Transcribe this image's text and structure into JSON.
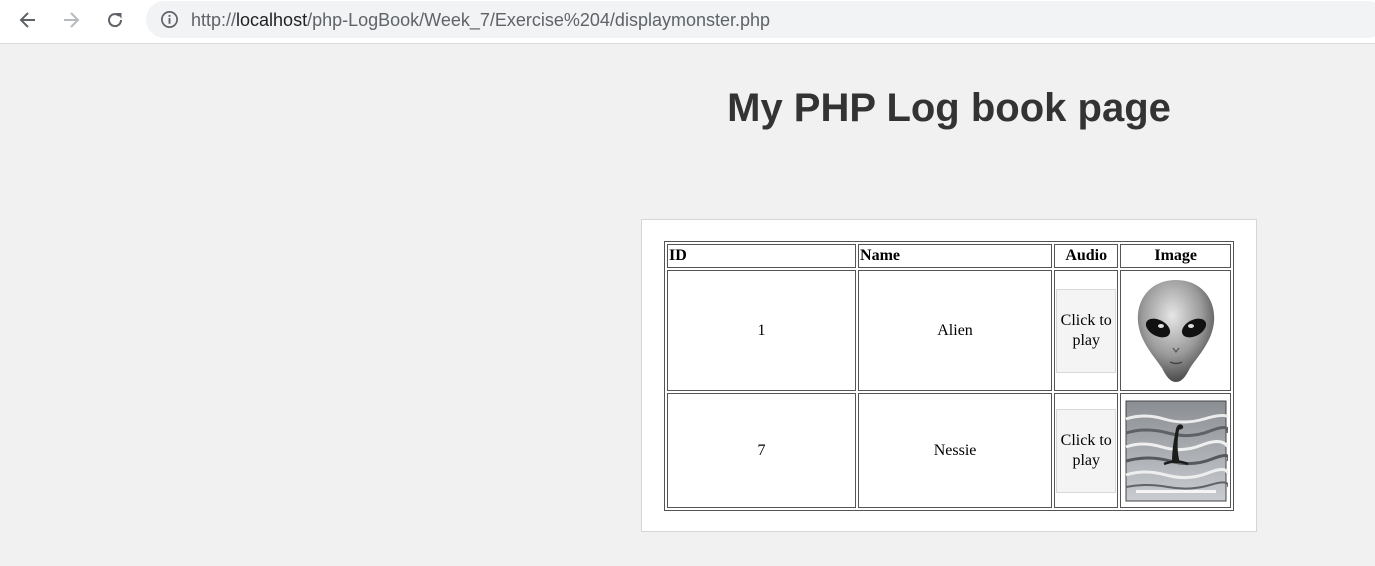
{
  "browser": {
    "url_prefix": "http://",
    "url_host": "localhost",
    "url_path": "/php-LogBook/Week_7/Exercise%204/displaymonster.php"
  },
  "page": {
    "title": "My PHP Log book page"
  },
  "table": {
    "headers": {
      "id": "ID",
      "name": "Name",
      "audio": "Audio",
      "image": "Image"
    },
    "rows": [
      {
        "id": "1",
        "name": "Alien",
        "audio_label": "Click to play",
        "image_icon": "alien-image"
      },
      {
        "id": "7",
        "name": "Nessie",
        "audio_label": "Click to play",
        "image_icon": "nessie-image"
      }
    ]
  },
  "colors": {
    "page_bg": "#f1f1f1",
    "title": "#333333",
    "omnibox_bg": "#f1f3f4"
  }
}
